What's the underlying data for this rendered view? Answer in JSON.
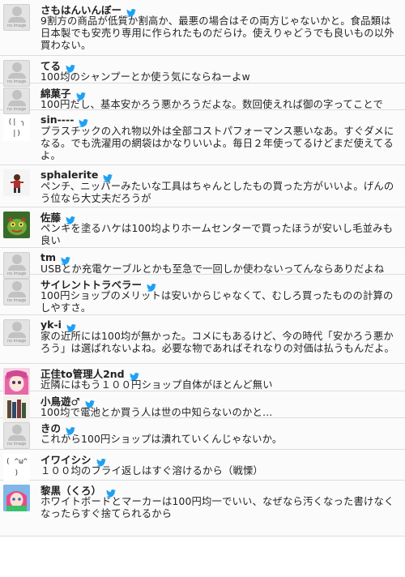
{
  "tweets": [
    {
      "name": "さもはんいんぼー",
      "text": "9割方の商品が低質か割高か、最悪の場合はその両方じゃないかと。食品類は日本製でも安売り専用に作られたものだらけ。使えりゃどうでも良いもの以外買わない。",
      "avatar": "noimage"
    },
    {
      "name": "てる",
      "text": "100均のシャンプーとか使う気にならねーよw",
      "avatar": "noimage"
    },
    {
      "name": "綿菓子",
      "text": "100円だし、基本安かろう悪かろうだよな。数回使えれば御の字ってことで",
      "avatar": "noimage"
    },
    {
      "name": "sin----",
      "text": "プラスチックの入れ物以外は全部コストパフォーマンス悪いなあ。すぐダメになる。でも洗濯用の網袋はかなりいいよ。毎日２年使ってるけどまだ使えてるよ。",
      "avatar": "face"
    },
    {
      "name": "sphalerite",
      "text": "ペンチ、ニッパーみたいな工具はちゃんとしたもの買った方がいいよ。げんのう位なら大丈夫だろうが",
      "avatar": "dark"
    },
    {
      "name": "佐藤",
      "text": "ペンキを塗るハケは100均よりホームセンターで買ったほうが安いし毛並みも良い",
      "avatar": "green"
    },
    {
      "name": "tm",
      "text": "USBとか充電ケーブルとかも至急で一回しか使わないってんならありだよね",
      "avatar": "noimage"
    },
    {
      "name": "サイレントトラベラー",
      "text": "100円ショップのメリットは安いからじゃなくて、むしろ買ったものの計算のしやすさ。",
      "avatar": "noimage"
    },
    {
      "name": "yk-i",
      "text": "家の近所には100均が無かった。コメにもあるけど、今の時代「安かろう悪かろう」は選ばれないよね。必要な物であればそれなりの対価は払うもんだよ。",
      "avatar": "noimage"
    },
    {
      "name": "正佳to管理人2nd",
      "text": "近隣にはもう１００円ショップ自体がほとんど無い",
      "avatar": "pink"
    },
    {
      "name": "小鳥遊♂",
      "text": "100均で電池とか買う人は世の中知らないのかと…",
      "avatar": "books"
    },
    {
      "name": "きの",
      "text": "これから100円ショップは潰れていくんじゃないか。",
      "avatar": "noimage"
    },
    {
      "name": "イワイシシ",
      "text": "１００均のフライ返しはすぐ溶けるから（戦慄）",
      "avatar": "face2"
    },
    {
      "name": "黎黒（くろ）",
      "text": "ホワイトボードとマーカーは100円均一でいい、なぜなら汚くなった書けなくなったらすぐ捨てられるから",
      "avatar": "colorful"
    }
  ],
  "noimage_caption": "no image",
  "face_glyph": "(|  ╮ |)",
  "face2_glyph": "( ^ω^ )",
  "bird_color": "#1da1f2",
  "icon": "twitter-bird-icon"
}
